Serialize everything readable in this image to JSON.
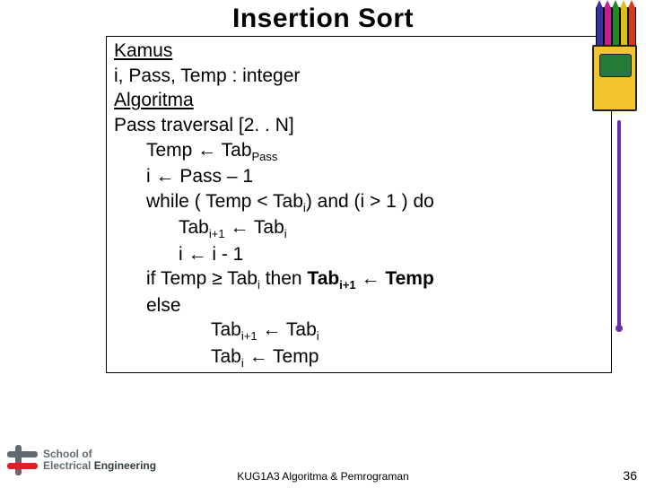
{
  "title": "Insertion Sort",
  "kamus_heading": "Kamus",
  "kamus_decl": "i, Pass, Temp : integer",
  "algoritma_heading": "Algoritma",
  "l_pass_traversal": "Pass traversal [2. . N]",
  "l_temp_assign_pre": "Temp ← Tab",
  "sub_pass": "Pass",
  "l_i_assign": "i ← Pass – 1",
  "l_while_pre": "while ( Temp < Tab",
  "sub_i": "i",
  "l_while_post": ") and (i > 1 ) do",
  "l_body1_pre": "Tab",
  "sub_i1": "i+1",
  "l_body1_mid": "  ← Tab",
  "l_body2": "i ← i - 1",
  "l_if_pre": "if Temp ≥ Tab",
  "l_if_mid": " then ",
  "l_if_tab": "Tab",
  "l_if_post": " ← Temp",
  "l_else": "else",
  "l_else1_pre": "Tab",
  "l_else1_mid": " ← Tab",
  "l_else2_pre": "Tab",
  "l_else2_post": " ← Temp",
  "footer": "KUG1A3 Algoritma & Pemrograman",
  "page": "36",
  "logo_line1": "School of",
  "logo_line2_a": "Electrical",
  "logo_line2_b": "Engineering"
}
